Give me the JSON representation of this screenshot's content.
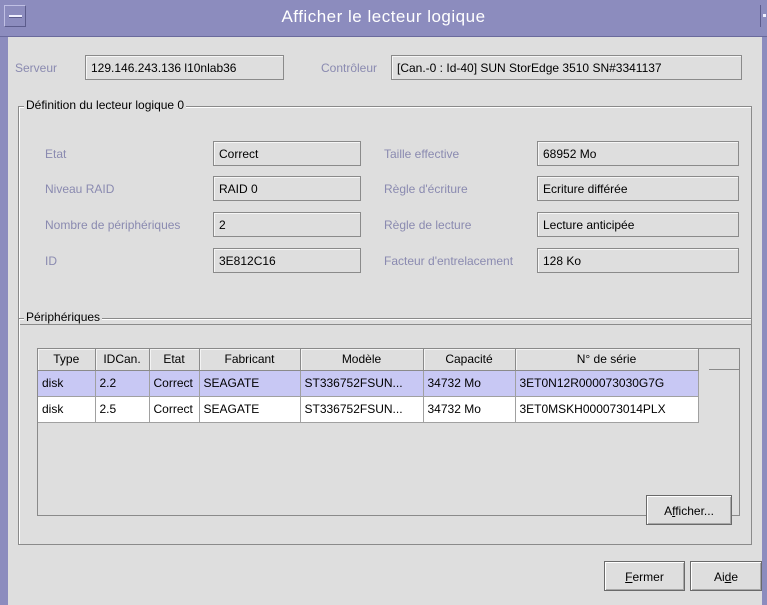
{
  "window": {
    "title": "Afficher le lecteur logique"
  },
  "top": {
    "server_label": "Serveur",
    "server_value": "129.146.243.136 l10nlab36",
    "controller_label": "Contrôleur",
    "controller_value": "[Can.-0 : Id-40] SUN StorEdge 3510 SN#3341137"
  },
  "definition": {
    "group_title": "Définition du lecteur logique 0",
    "state_label": "Etat",
    "state_value": "Correct",
    "raid_label": "Niveau RAID",
    "raid_value": "RAID 0",
    "devices_label": "Nombre de périphériques",
    "devices_value": "2",
    "id_label": "ID",
    "id_value": "3E812C16",
    "size_label": "Taille effective",
    "size_value": "68952 Mo",
    "write_label": "Règle d'écriture",
    "write_value": "Ecriture différée",
    "read_label": "Règle de lecture",
    "read_value": "Lecture anticipée",
    "stripe_label": "Facteur d'entrelacement",
    "stripe_value": "128 Ko"
  },
  "devices": {
    "group_title": "Périphériques",
    "columns": [
      "Type",
      "IDCan.",
      "Etat",
      "Fabricant",
      "Modèle",
      "Capacité",
      "N° de série"
    ],
    "rows": [
      [
        "disk",
        "2.2",
        "Correct",
        "SEAGATE",
        "ST336752FSUN...",
        "34732 Mo",
        "3ET0N12R000073030G7G"
      ],
      [
        "disk",
        "2.5",
        "Correct",
        "SEAGATE",
        "ST336752FSUN...",
        "34732 Mo",
        "3ET0MSKH000073014PLX"
      ]
    ],
    "show_button": {
      "pre": "A",
      "mnemonic": "f",
      "post": "ficher..."
    }
  },
  "footer": {
    "close_button": {
      "pre": "",
      "mnemonic": "F",
      "post": "ermer"
    },
    "help_button": {
      "pre": "Ai",
      "mnemonic": "d",
      "post": "e"
    }
  },
  "colors": {
    "titlebar": "#8c8cbe",
    "selected_row": "#c8c8f4",
    "dim_label": "#8a8ab0"
  }
}
